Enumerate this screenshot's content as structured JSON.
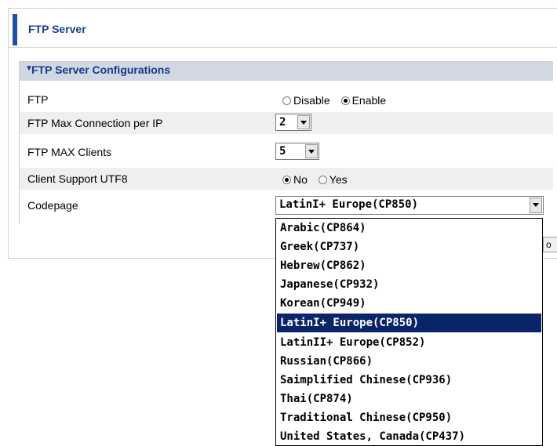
{
  "header": {
    "title": "FTP Server"
  },
  "section": {
    "title": "FTP Server Configurations"
  },
  "rows": {
    "ftp": {
      "label": "FTP",
      "options": [
        "Disable",
        "Enable"
      ],
      "selected": "Enable"
    },
    "max_conn": {
      "label": "FTP Max Connection per IP",
      "value": "2"
    },
    "max_clients": {
      "label": "FTP MAX Clients",
      "value": "5"
    },
    "utf8": {
      "label": "Client Support UTF8",
      "options": [
        "No",
        "Yes"
      ],
      "selected": "No"
    },
    "codepage": {
      "label": "Codepage",
      "value": "LatinI+ Europe(CP850)"
    }
  },
  "codepage_options": [
    "Arabic(CP864)",
    "Greek(CP737)",
    "Hebrew(CP862)",
    "Japanese(CP932)",
    "Korean(CP949)",
    "LatinI+ Europe(CP850)",
    "LatinII+ Europe(CP852)",
    "Russian(CP866)",
    "Saimplified Chinese(CP936)",
    "Thai(CP874)",
    "Traditional Chinese(CP950)",
    "United States, Canada(CP437)"
  ],
  "hidden_button_partial": "o",
  "colors": {
    "accent": "#1f4fa6",
    "section_bg": "#cfd8e3",
    "selection": "#0a246a"
  }
}
